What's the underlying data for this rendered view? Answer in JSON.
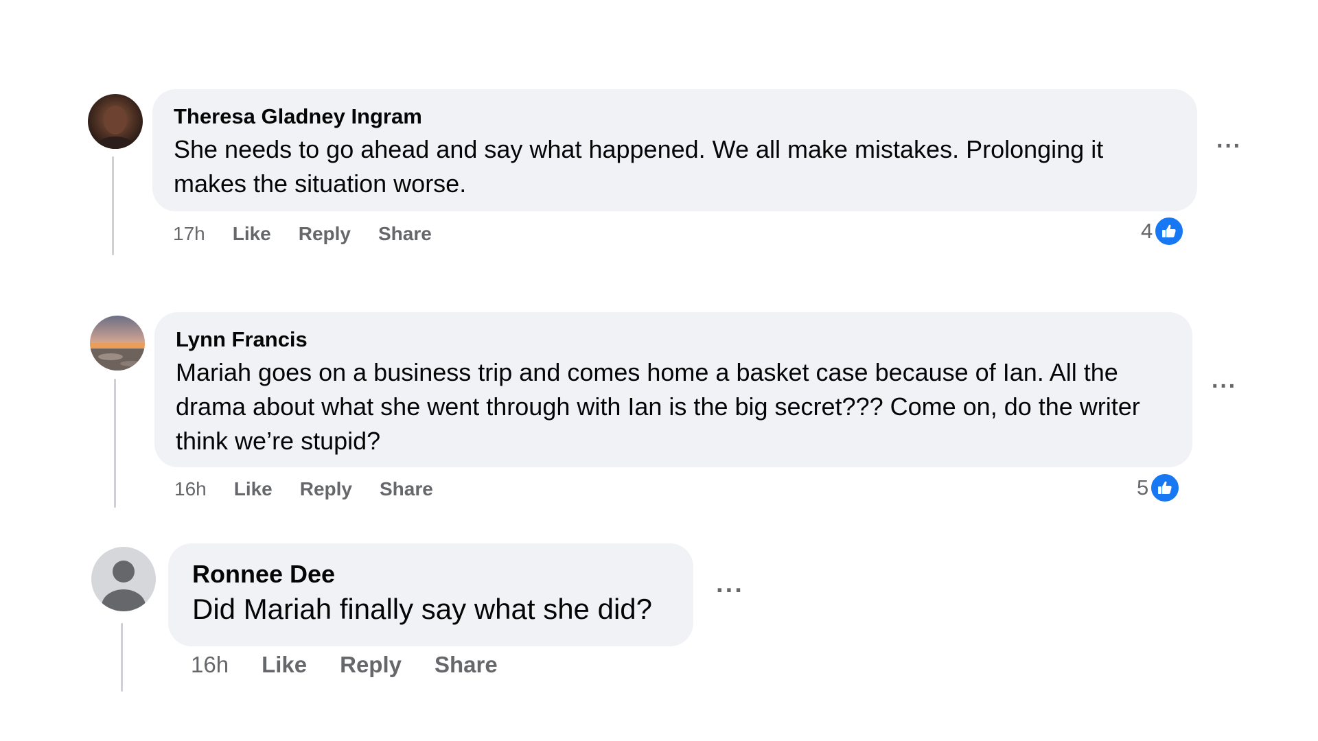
{
  "comments": [
    {
      "author": "Theresa Gladney Ingram",
      "text": "She needs to go ahead and say what happened. We all make mistakes. Prolonging it makes the situation worse.",
      "time": "17h",
      "like_label": "Like",
      "reply_label": "Reply",
      "share_label": "Share",
      "reaction_count": "4",
      "more_label": "···",
      "avatar_icon": "profile-photo"
    },
    {
      "author": "Lynn Francis",
      "text": "Mariah goes on a business trip and comes home a basket case because of Ian. All the drama about what she went through with Ian is the big secret??? Come on, do the writer think we’re stupid?",
      "time": "16h",
      "like_label": "Like",
      "reply_label": "Reply",
      "share_label": "Share",
      "reaction_count": "5",
      "more_label": "···",
      "avatar_icon": "sunset-photo"
    },
    {
      "author": "Ronnee Dee",
      "text": "Did Mariah finally say what she did?",
      "time": "16h",
      "like_label": "Like",
      "reply_label": "Reply",
      "share_label": "Share",
      "more_label": "···",
      "avatar_icon": "default-avatar-icon"
    }
  ],
  "colors": {
    "bubble": "#f0f2f5",
    "meta_text": "#65676b",
    "like_blue": "#1877f2",
    "thread_line": "#ced0d4"
  }
}
